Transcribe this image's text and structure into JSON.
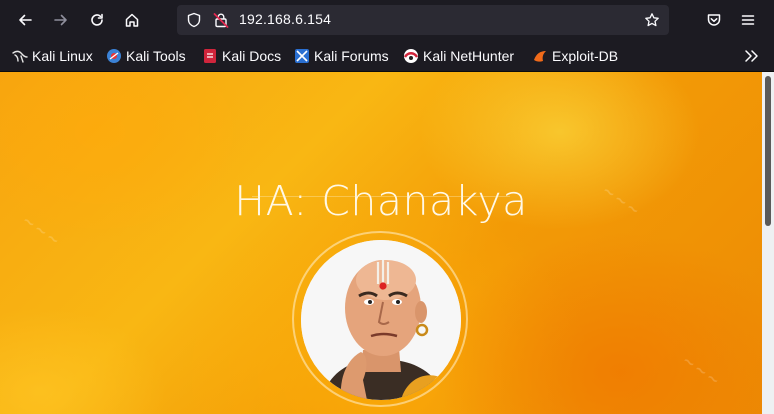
{
  "browser": {
    "url": "192.168.6.154",
    "icons": [
      "back-icon",
      "forward-icon",
      "reload-icon",
      "home-icon",
      "shield-icon",
      "lock-insecure-icon",
      "star-icon",
      "pocket-icon",
      "menu-icon",
      "overflow-chevron-icon"
    ]
  },
  "bookmarks": [
    {
      "label": "Kali Linux",
      "icon": "kali-dragon-icon"
    },
    {
      "label": "Kali Tools",
      "icon": "kali-tools-icon"
    },
    {
      "label": "Kali Docs",
      "icon": "kali-docs-icon"
    },
    {
      "label": "Kali Forums",
      "icon": "kali-forums-icon"
    },
    {
      "label": "Kali NetHunter",
      "icon": "nethunter-icon"
    },
    {
      "label": "Exploit-DB",
      "icon": "exploit-db-icon"
    }
  ],
  "page": {
    "title": "HA: Chanakya",
    "background_colors": [
      "#f7a40f",
      "#f9b713",
      "#ec8a04"
    ]
  },
  "colors": {
    "toolbar_bg": "#1c1b22",
    "urlbar_bg": "#2b2a33",
    "text": "#fbfbfe",
    "accent_red": "#e22850"
  }
}
